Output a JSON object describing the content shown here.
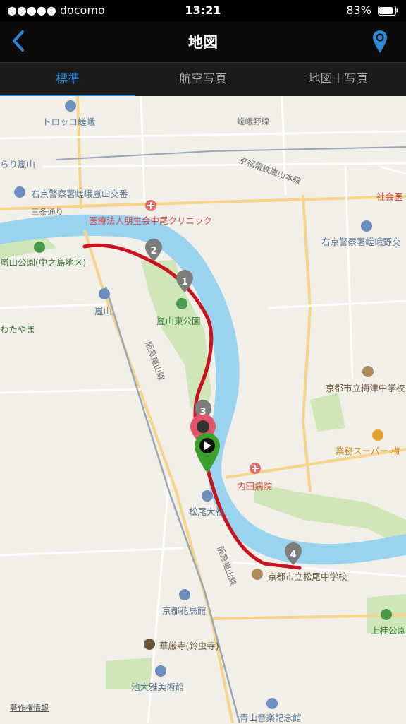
{
  "status_bar": {
    "carrier": "●●●●● docomo",
    "time": "13:21",
    "battery": "83%"
  },
  "nav": {
    "title": "地図"
  },
  "tabs": [
    {
      "label": "標準",
      "active": true
    },
    {
      "label": "航空写真",
      "active": false
    },
    {
      "label": "地図＋写真",
      "active": false
    }
  ],
  "map": {
    "labels": {
      "torokko": "トロッコ嵯峨",
      "saga_line": "嵯峨野線",
      "keifuku": "京福電鉄嵐山本線",
      "arashiyama_station_top": "らり嵐山",
      "police_saga": "右京警察署嵯峨嵐山交番",
      "sanjo": "三条通り",
      "clinic": "医療法人朋生会中尾クリニック",
      "shakai": "社会医",
      "police_right": "右京警察署嵯峨野交",
      "nakanoshima_park": "嵐山公園(中之島地区)",
      "arashiyama": "嵐山",
      "higashi_park": "嵐山東公園",
      "hankyu_line": "阪急嵐山線",
      "watayama": "わたやま",
      "umezu_school": "京都市立梅津中学校",
      "supermarket": "業務スーパー 梅",
      "uchida": "内田病院",
      "matsuo_taisha": "松尾大社",
      "hankyu_line2": "阪急嵐山線",
      "matsuo_school": "京都市立松尾中学校",
      "hanatori": "京都花鳥館",
      "kegonji": "華厳寺(鈴虫寺)",
      "kamikatsura_park": "上桂公園",
      "ikeo_museum": "池大雅美術館",
      "aoyama": "青山音楽記念館"
    },
    "markers": [
      "1",
      "2",
      "3",
      "4"
    ],
    "route_color": "#c8141e",
    "copyright": "著作権情報"
  }
}
